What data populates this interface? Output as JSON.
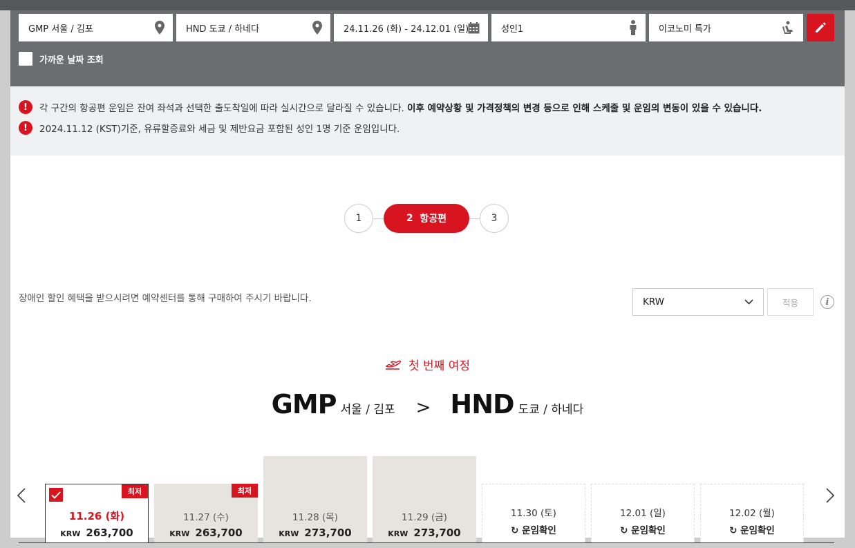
{
  "search": {
    "origin": "GMP 서울 / 김포",
    "destination": "HND 도쿄 / 하네다",
    "dates": "24.11.26 (화) - 24.12.01 (일)",
    "passengers": "성인1",
    "cabin": "이코노미 특가",
    "nearby_dates_label": "가까운 날짜 조회"
  },
  "notices": {
    "line1_text": "각 구간의 항공편 운임은 잔여 좌석과 선택한 출도착일에 따라 실시간으로 달라질 수 있습니다. ",
    "line1_bold": "이후 예약상황 및 가격정책의 변경 등으로 인해 스케줄 및 운임의 변동이 있을 수 있습니다.",
    "line2_text": "2024.11.12 (KST)기준, 유류할증료와 세금 및 제반요금 포함된 성인 1명 기준 운임입니다.",
    "alert_glyph": "!"
  },
  "steps": {
    "step1": "1",
    "step2_num": "2",
    "step2_label": "항공편",
    "step3": "3"
  },
  "disclaimer": "장애인 할인 혜택을 받으시려면 예약센터를 통해 구매하여 주시기 바랍니다.",
  "currency": {
    "selected": "KRW",
    "apply_label": "적용",
    "info_glyph": "i"
  },
  "journey": {
    "label": "첫 번째 여정",
    "origin_code": "GMP",
    "origin_city": "서울 / 김포",
    "arrow": ">",
    "dest_code": "HND",
    "dest_city": "도쿄 / 하네다"
  },
  "nav": {
    "prev": "‹",
    "next": "›"
  },
  "dates": [
    {
      "date": "11.26 (화)",
      "currency": "KRW",
      "price": "263,700",
      "badge": "최저"
    },
    {
      "date": "11.27 (수)",
      "currency": "KRW",
      "price": "263,700",
      "badge": "최저"
    },
    {
      "date": "11.28 (목)",
      "currency": "KRW",
      "price": "273,700"
    },
    {
      "date": "11.29 (금)",
      "currency": "KRW",
      "price": "273,700"
    },
    {
      "date": "11.30 (토)",
      "check_label": "운임확인"
    },
    {
      "date": "12.01 (일)",
      "check_label": "운임확인"
    },
    {
      "date": "12.02 (월)",
      "check_label": "운임확인"
    }
  ],
  "colors": {
    "brand_red": "#d7141f",
    "panel_gray": "#6b6d70",
    "notice_bg": "#f0f1f3"
  }
}
